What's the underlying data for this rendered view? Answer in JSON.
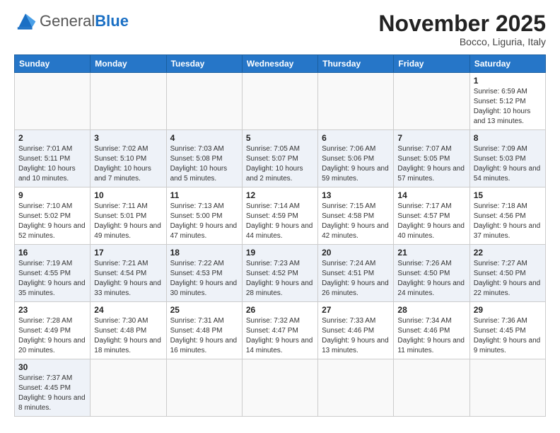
{
  "logo": {
    "general": "General",
    "blue": "Blue"
  },
  "title": "November 2025",
  "location": "Bocco, Liguria, Italy",
  "days_of_week": [
    "Sunday",
    "Monday",
    "Tuesday",
    "Wednesday",
    "Thursday",
    "Friday",
    "Saturday"
  ],
  "weeks": [
    {
      "days": [
        {
          "num": "",
          "info": ""
        },
        {
          "num": "",
          "info": ""
        },
        {
          "num": "",
          "info": ""
        },
        {
          "num": "",
          "info": ""
        },
        {
          "num": "",
          "info": ""
        },
        {
          "num": "",
          "info": ""
        },
        {
          "num": "1",
          "info": "Sunrise: 6:59 AM\nSunset: 5:12 PM\nDaylight: 10 hours and 13 minutes."
        }
      ]
    },
    {
      "days": [
        {
          "num": "2",
          "info": "Sunrise: 7:01 AM\nSunset: 5:11 PM\nDaylight: 10 hours and 10 minutes."
        },
        {
          "num": "3",
          "info": "Sunrise: 7:02 AM\nSunset: 5:10 PM\nDaylight: 10 hours and 7 minutes."
        },
        {
          "num": "4",
          "info": "Sunrise: 7:03 AM\nSunset: 5:08 PM\nDaylight: 10 hours and 5 minutes."
        },
        {
          "num": "5",
          "info": "Sunrise: 7:05 AM\nSunset: 5:07 PM\nDaylight: 10 hours and 2 minutes."
        },
        {
          "num": "6",
          "info": "Sunrise: 7:06 AM\nSunset: 5:06 PM\nDaylight: 9 hours and 59 minutes."
        },
        {
          "num": "7",
          "info": "Sunrise: 7:07 AM\nSunset: 5:05 PM\nDaylight: 9 hours and 57 minutes."
        },
        {
          "num": "8",
          "info": "Sunrise: 7:09 AM\nSunset: 5:03 PM\nDaylight: 9 hours and 54 minutes."
        }
      ]
    },
    {
      "days": [
        {
          "num": "9",
          "info": "Sunrise: 7:10 AM\nSunset: 5:02 PM\nDaylight: 9 hours and 52 minutes."
        },
        {
          "num": "10",
          "info": "Sunrise: 7:11 AM\nSunset: 5:01 PM\nDaylight: 9 hours and 49 minutes."
        },
        {
          "num": "11",
          "info": "Sunrise: 7:13 AM\nSunset: 5:00 PM\nDaylight: 9 hours and 47 minutes."
        },
        {
          "num": "12",
          "info": "Sunrise: 7:14 AM\nSunset: 4:59 PM\nDaylight: 9 hours and 44 minutes."
        },
        {
          "num": "13",
          "info": "Sunrise: 7:15 AM\nSunset: 4:58 PM\nDaylight: 9 hours and 42 minutes."
        },
        {
          "num": "14",
          "info": "Sunrise: 7:17 AM\nSunset: 4:57 PM\nDaylight: 9 hours and 40 minutes."
        },
        {
          "num": "15",
          "info": "Sunrise: 7:18 AM\nSunset: 4:56 PM\nDaylight: 9 hours and 37 minutes."
        }
      ]
    },
    {
      "days": [
        {
          "num": "16",
          "info": "Sunrise: 7:19 AM\nSunset: 4:55 PM\nDaylight: 9 hours and 35 minutes."
        },
        {
          "num": "17",
          "info": "Sunrise: 7:21 AM\nSunset: 4:54 PM\nDaylight: 9 hours and 33 minutes."
        },
        {
          "num": "18",
          "info": "Sunrise: 7:22 AM\nSunset: 4:53 PM\nDaylight: 9 hours and 30 minutes."
        },
        {
          "num": "19",
          "info": "Sunrise: 7:23 AM\nSunset: 4:52 PM\nDaylight: 9 hours and 28 minutes."
        },
        {
          "num": "20",
          "info": "Sunrise: 7:24 AM\nSunset: 4:51 PM\nDaylight: 9 hours and 26 minutes."
        },
        {
          "num": "21",
          "info": "Sunrise: 7:26 AM\nSunset: 4:50 PM\nDaylight: 9 hours and 24 minutes."
        },
        {
          "num": "22",
          "info": "Sunrise: 7:27 AM\nSunset: 4:50 PM\nDaylight: 9 hours and 22 minutes."
        }
      ]
    },
    {
      "days": [
        {
          "num": "23",
          "info": "Sunrise: 7:28 AM\nSunset: 4:49 PM\nDaylight: 9 hours and 20 minutes."
        },
        {
          "num": "24",
          "info": "Sunrise: 7:30 AM\nSunset: 4:48 PM\nDaylight: 9 hours and 18 minutes."
        },
        {
          "num": "25",
          "info": "Sunrise: 7:31 AM\nSunset: 4:48 PM\nDaylight: 9 hours and 16 minutes."
        },
        {
          "num": "26",
          "info": "Sunrise: 7:32 AM\nSunset: 4:47 PM\nDaylight: 9 hours and 14 minutes."
        },
        {
          "num": "27",
          "info": "Sunrise: 7:33 AM\nSunset: 4:46 PM\nDaylight: 9 hours and 13 minutes."
        },
        {
          "num": "28",
          "info": "Sunrise: 7:34 AM\nSunset: 4:46 PM\nDaylight: 9 hours and 11 minutes."
        },
        {
          "num": "29",
          "info": "Sunrise: 7:36 AM\nSunset: 4:45 PM\nDaylight: 9 hours and 9 minutes."
        }
      ]
    },
    {
      "days": [
        {
          "num": "30",
          "info": "Sunrise: 7:37 AM\nSunset: 4:45 PM\nDaylight: 9 hours and 8 minutes."
        },
        {
          "num": "",
          "info": ""
        },
        {
          "num": "",
          "info": ""
        },
        {
          "num": "",
          "info": ""
        },
        {
          "num": "",
          "info": ""
        },
        {
          "num": "",
          "info": ""
        },
        {
          "num": "",
          "info": ""
        }
      ]
    }
  ]
}
